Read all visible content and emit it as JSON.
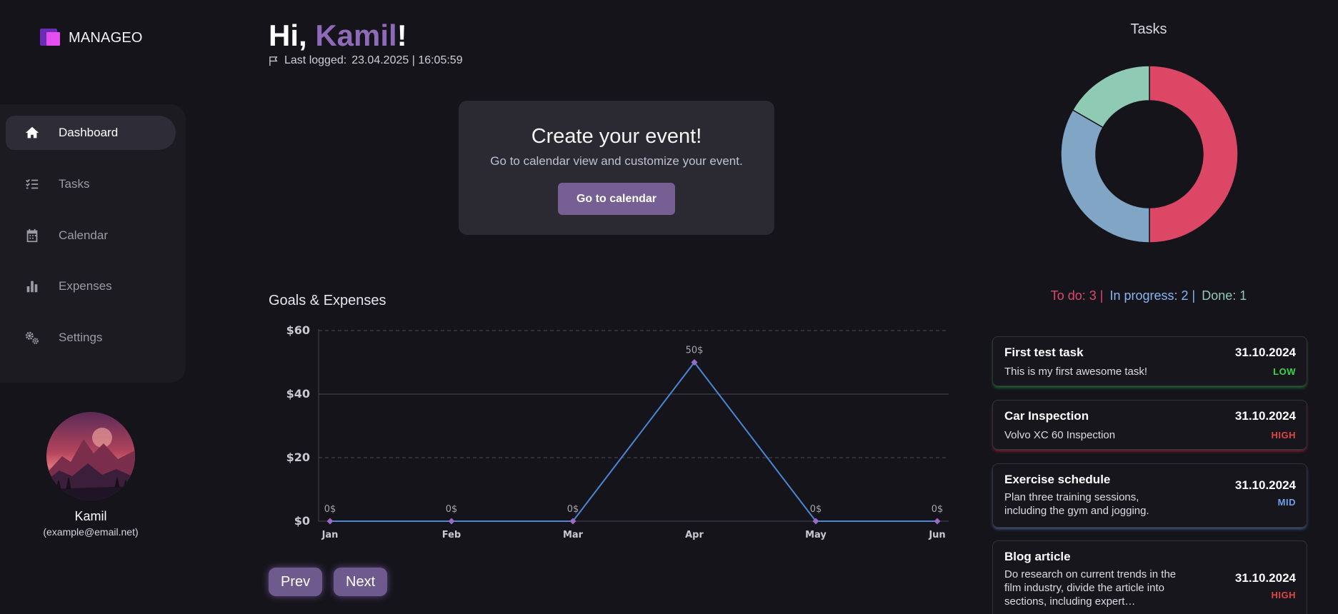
{
  "app": {
    "name": "MANAGEO"
  },
  "sidebar": {
    "items": [
      {
        "label": "Dashboard",
        "icon": "home-icon",
        "active": true
      },
      {
        "label": "Tasks",
        "icon": "task-list-icon",
        "active": false
      },
      {
        "label": "Calendar",
        "icon": "calendar-icon",
        "active": false
      },
      {
        "label": "Expenses",
        "icon": "bar-chart-icon",
        "active": false
      },
      {
        "label": "Settings",
        "icon": "gears-icon",
        "active": false
      }
    ]
  },
  "profile": {
    "name": "Kamil",
    "email": "(example@email.net)"
  },
  "header": {
    "greeting_prefix": "Hi, ",
    "user_name": "Kamil",
    "greeting_suffix": "!",
    "last_logged_label": "Last logged:",
    "last_logged_value": "23.04.2025 | 16:05:59"
  },
  "event_card": {
    "title": "Create your event!",
    "subtitle": "Go to calendar view and customize your event.",
    "button_label": "Go to calendar"
  },
  "goals": {
    "title": "Goals & Expenses",
    "prev_label": "Prev",
    "next_label": "Next"
  },
  "chart_data": {
    "type": "line",
    "title": "Goals & Expenses",
    "categories": [
      "Jan",
      "Feb",
      "Mar",
      "Apr",
      "May",
      "Jun"
    ],
    "values": [
      0,
      0,
      0,
      50,
      0,
      0
    ],
    "data_labels": [
      "0$",
      "0$",
      "0$",
      "50$",
      "0$",
      "0$"
    ],
    "yticks": [
      0,
      20,
      40,
      60
    ],
    "ytick_labels": [
      "$0",
      "$20",
      "$40",
      "$60"
    ],
    "ylim": [
      0,
      60
    ],
    "grid": true,
    "line_color": "#4a86d4",
    "marker_color": "#9a6bc6"
  },
  "tasks": {
    "title": "Tasks",
    "donut": {
      "slices": [
        {
          "label": "To do",
          "value": 3,
          "color": "#dd4766"
        },
        {
          "label": "In progress",
          "value": 2,
          "color": "#81a5c5"
        },
        {
          "label": "Done",
          "value": 1,
          "color": "#8fcbb4"
        }
      ]
    },
    "summary": {
      "todo": "To do: 3 |",
      "in_progress": "In progress: 2 |",
      "done": "Done: 1"
    },
    "colors": {
      "todo": "#e0486b",
      "in_progress": "#87b6ee",
      "done": "#8fcbb4"
    },
    "items": [
      {
        "title": "First test task",
        "date": "31.10.2024",
        "description": "This is my first awesome task!",
        "priority": "LOW",
        "priority_color": "#35d84a"
      },
      {
        "title": "Car Inspection",
        "date": "31.10.2024",
        "description": "Volvo XC 60 Inspection",
        "priority": "HIGH",
        "priority_color": "#e24444"
      },
      {
        "title": "Exercise schedule",
        "date": "31.10.2024",
        "description": "Plan three training sessions, including the gym and jogging.",
        "priority": "MID",
        "priority_color": "#6fa0e8"
      },
      {
        "title": "Blog article",
        "date": "31.10.2024",
        "description": "Do research on current trends in the film industry, divide the article into sections, including expert…",
        "priority": "HIGH",
        "priority_color": "#e24444"
      }
    ]
  }
}
